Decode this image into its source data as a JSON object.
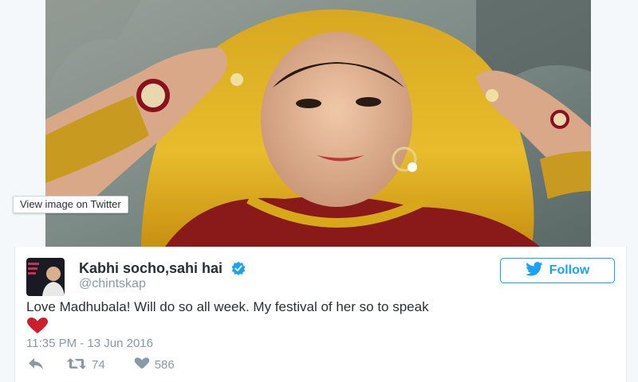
{
  "media": {
    "tooltip": "View image on Twitter"
  },
  "tweet": {
    "user_name": "Kabhi socho,sahi hai",
    "user_handle": "@chintskap",
    "follow_label": "Follow",
    "text": "Love Madhubala! Will do so all week. My festival of her so to speak",
    "timestamp": "11:35 PM - 13 Jun 2016",
    "retweets": "74",
    "likes": "586"
  },
  "icons": {
    "reply": "reply-icon",
    "retweet": "retweet-icon",
    "like": "heart-icon",
    "verified": "verified-badge-icon",
    "twitter_bird": "twitter-bird-icon"
  },
  "colors": {
    "twitter_blue": "#1da1f2",
    "muted_text": "#8899a6",
    "heart_red": "#cc1f2e"
  }
}
